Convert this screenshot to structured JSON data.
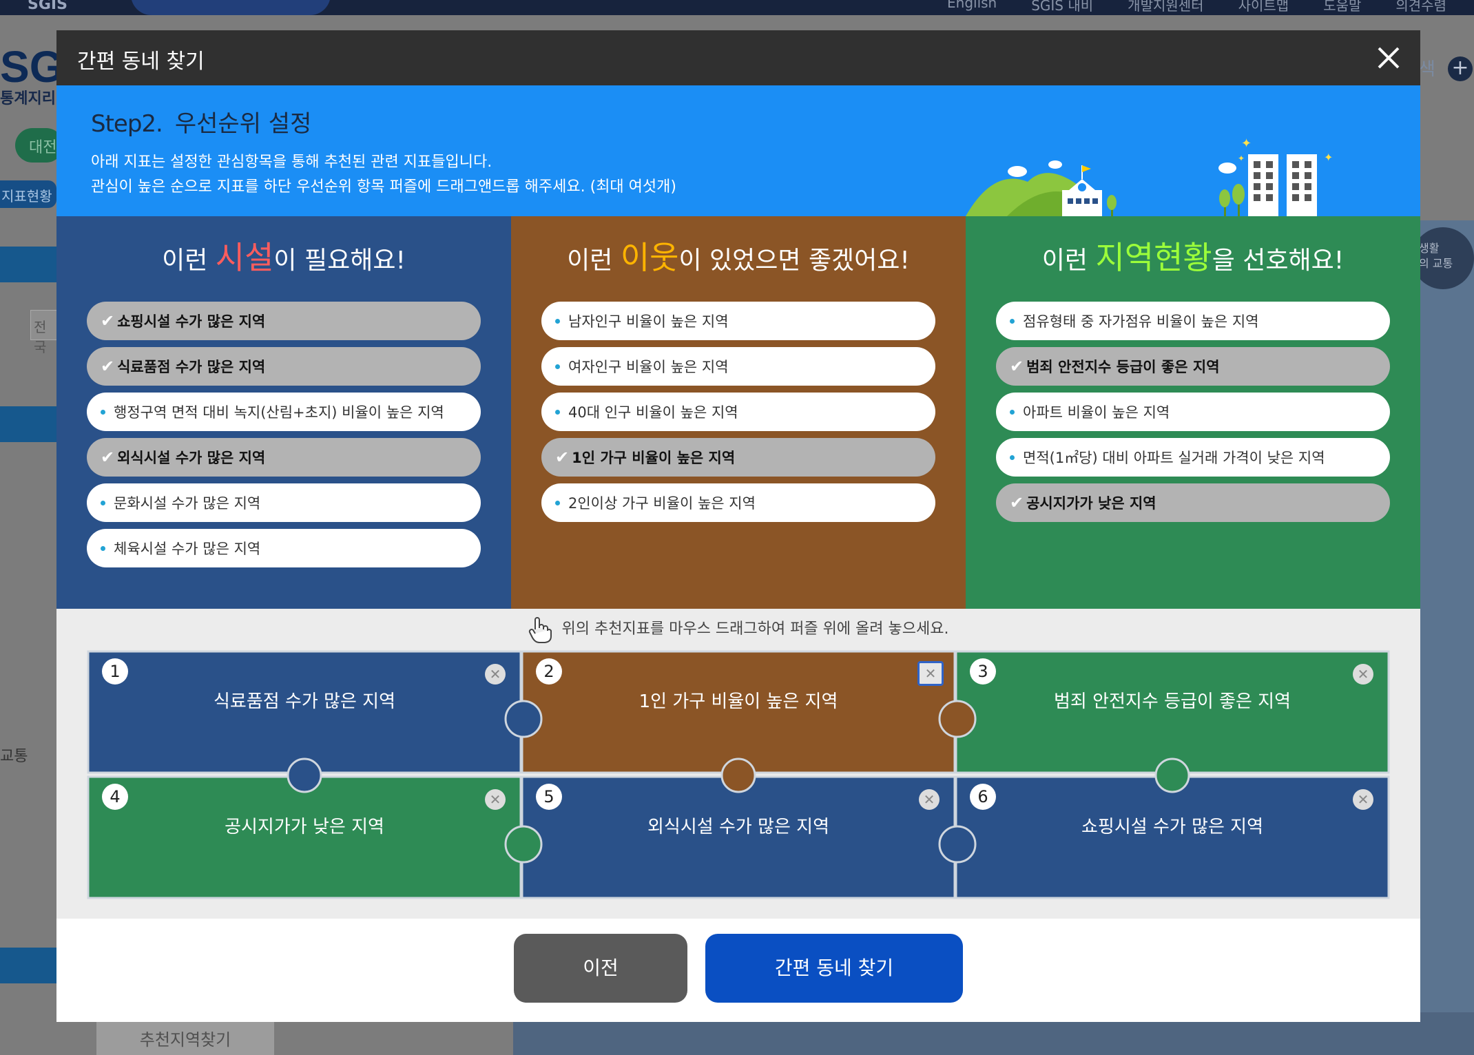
{
  "background": {
    "logo_mini": "SGIS",
    "nav": [
      "English",
      "SGIS 내비",
      "개발지원센터",
      "사이트맵",
      "도움말",
      "의견수렴"
    ],
    "logo": "SGI",
    "logo_sub": "통계지리",
    "pill_green": "대전",
    "pill_blue": "지표현황",
    "input_text": "전국",
    "side_text": "교통",
    "bottom_button": "추천지역찾기",
    "right_search": "색",
    "right_circle": "생활\n의 교통"
  },
  "modal": {
    "title": "간편 동네 찾기",
    "step": {
      "number": "Step2.",
      "title": "우선순위 설정",
      "desc_line1": "아래 지표는 설정한 관심항목을 통해 추천된 관련 지표들입니다.",
      "desc_line2": "관심이 높은 순으로 지표를 하단 우선순위 항목 퍼즐에 드래그앤드롭 해주세요. (최대 여섯개)"
    },
    "columns": [
      {
        "head_pre": "이런 ",
        "head_hl": "시설",
        "head_post": "이 필요해요!",
        "items": [
          {
            "label": "쇼핑시설 수가 많은 지역",
            "selected": true
          },
          {
            "label": "식료품점 수가 많은 지역",
            "selected": true
          },
          {
            "label": "행정구역 면적 대비 녹지(산림+초지) 비율이 높은 지역",
            "selected": false
          },
          {
            "label": "외식시설 수가 많은 지역",
            "selected": true
          },
          {
            "label": "문화시설 수가 많은 지역",
            "selected": false
          },
          {
            "label": "체육시설 수가 많은 지역",
            "selected": false
          }
        ]
      },
      {
        "head_pre": "이런 ",
        "head_hl": "이웃",
        "head_post": "이 있었으면 좋겠어요!",
        "items": [
          {
            "label": "남자인구 비율이 높은 지역",
            "selected": false
          },
          {
            "label": "여자인구 비율이 높은 지역",
            "selected": false
          },
          {
            "label": "40대 인구 비율이 높은 지역",
            "selected": false
          },
          {
            "label": "1인 가구 비율이 높은 지역",
            "selected": true
          },
          {
            "label": "2인이상 가구 비율이 높은 지역",
            "selected": false
          }
        ]
      },
      {
        "head_pre": "이런 ",
        "head_hl": "지역현황",
        "head_post": "을 선호해요!",
        "items": [
          {
            "label": "점유형태 중 자가점유 비율이 높은 지역",
            "selected": false
          },
          {
            "label": "범죄 안전지수 등급이 좋은 지역",
            "selected": true
          },
          {
            "label": "아파트 비율이 높은 지역",
            "selected": false
          },
          {
            "label": "면적(1㎡당) 대비 아파트 실거래 가격이 낮은 지역",
            "selected": false
          },
          {
            "label": "공시지가가 낮은 지역",
            "selected": true
          }
        ]
      }
    ],
    "puzzle_hint": "위의 추천지표를 마우스 드래그하여 퍼즐 위에 올려 놓으세요.",
    "pieces": [
      {
        "num": "1",
        "label": "식료품점 수가 많은 지역",
        "color": "#2a5189"
      },
      {
        "num": "2",
        "label": "1인 가구 비율이 높은 지역",
        "color": "#8b5526"
      },
      {
        "num": "3",
        "label": "범죄 안전지수 등급이 좋은 지역",
        "color": "#2e8b55"
      },
      {
        "num": "4",
        "label": "공시지가가 낮은 지역",
        "color": "#2e8b55"
      },
      {
        "num": "5",
        "label": "외식시설 수가 많은 지역",
        "color": "#2a5189"
      },
      {
        "num": "6",
        "label": "쇼핑시설 수가 많은 지역",
        "color": "#2a5189"
      }
    ],
    "btn_prev": "이전",
    "btn_find": "간편 동네 찾기"
  },
  "colors": {
    "blue": "#2a5189",
    "brown": "#8b5526",
    "green": "#2e8b55",
    "banner": "#1b8ef5",
    "primary_button": "#0a4fc2"
  }
}
